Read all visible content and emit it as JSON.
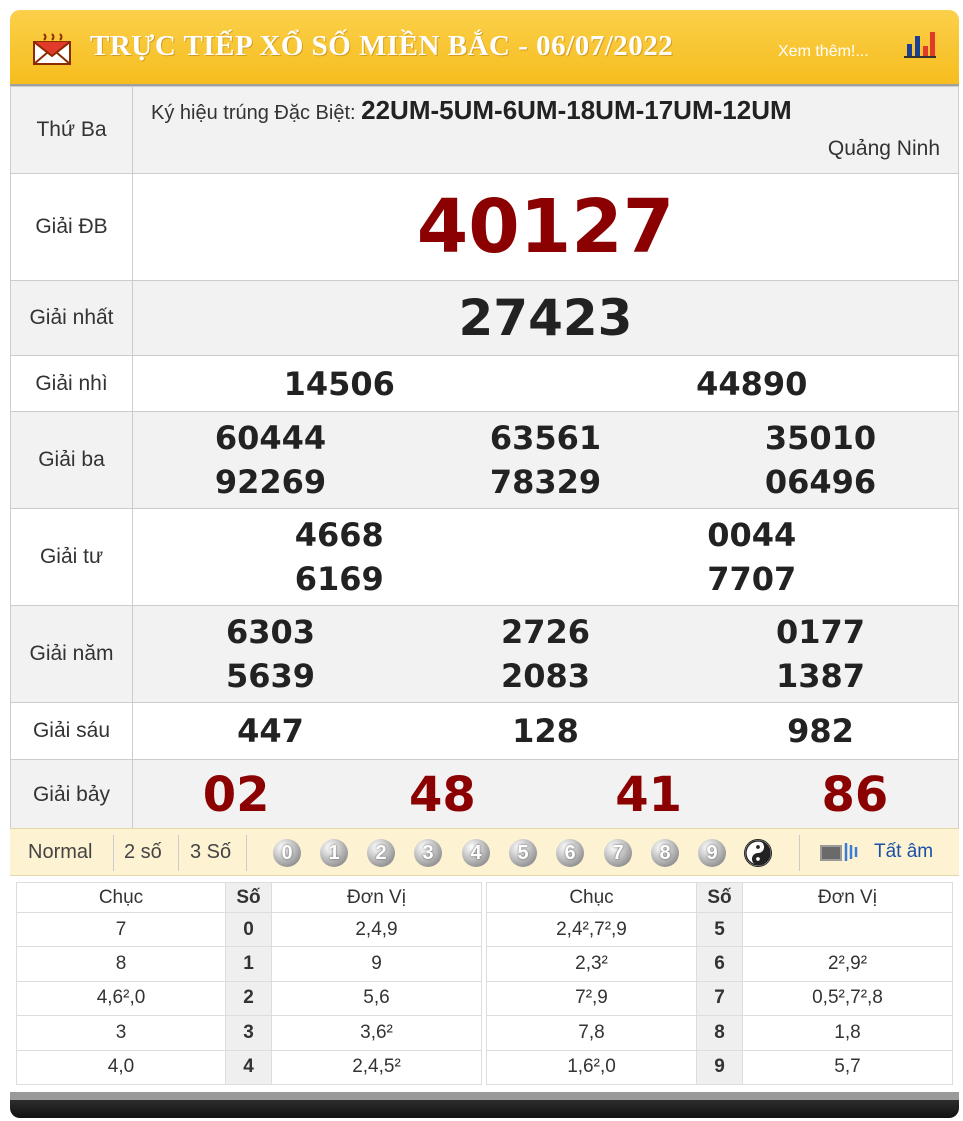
{
  "header": {
    "title": "TRỰC TIẾP XỔ SỐ MIỀN BẮC - 06/07/2022",
    "more_link": "Xem thêm!...",
    "colors": {
      "bar": "#f6bd1e",
      "title_text": "#ffffff"
    },
    "icons": [
      "mail-icon",
      "bar-chart-icon"
    ]
  },
  "draw": {
    "weekday": "Thứ Ba",
    "symbol_label": "Ký hiệu trúng Đặc Biệt:",
    "symbols": "22UM-5UM-6UM-18UM-17UM-12UM",
    "province": "Quảng Ninh"
  },
  "prizes": {
    "db": {
      "label": "Giải ĐB",
      "numbers": [
        "40127"
      ]
    },
    "g1": {
      "label": "Giải nhất",
      "numbers": [
        "27423"
      ]
    },
    "g2": {
      "label": "Giải nhì",
      "numbers": [
        "14506",
        "44890"
      ]
    },
    "g3": {
      "label": "Giải ba",
      "numbers": [
        "60444",
        "63561",
        "35010",
        "92269",
        "78329",
        "06496"
      ]
    },
    "g4": {
      "label": "Giải tư",
      "numbers": [
        "4668",
        "0044",
        "6169",
        "7707"
      ]
    },
    "g5": {
      "label": "Giải năm",
      "numbers": [
        "6303",
        "2726",
        "0177",
        "5639",
        "2083",
        "1387"
      ]
    },
    "g6": {
      "label": "Giải sáu",
      "numbers": [
        "447",
        "128",
        "982"
      ]
    },
    "g7": {
      "label": "Giải bảy",
      "numbers": [
        "02",
        "48",
        "41",
        "86"
      ]
    }
  },
  "highlight_color": "#8b0000",
  "filter": {
    "options": [
      "Normal",
      "2 số",
      "3 Số"
    ],
    "digits": [
      "0",
      "1",
      "2",
      "3",
      "4",
      "5",
      "6",
      "7",
      "8",
      "9"
    ],
    "mute_label": "Tất âm"
  },
  "loto": {
    "headers": {
      "chuc": "Chục",
      "so": "Số",
      "donvi": "Đơn Vị"
    },
    "left": [
      {
        "chuc": "7",
        "so": "0",
        "donvi": "2,4,9"
      },
      {
        "chuc": "8",
        "so": "1",
        "donvi": "9"
      },
      {
        "chuc": "4,6²,0",
        "so": "2",
        "donvi": "5,6"
      },
      {
        "chuc": "3",
        "so": "3",
        "donvi": "3,6²"
      },
      {
        "chuc": "4,0",
        "so": "4",
        "donvi": "2,4,5²"
      }
    ],
    "right": [
      {
        "chuc": "2,4²,7²,9",
        "so": "5",
        "donvi": ""
      },
      {
        "chuc": "2,3²",
        "so": "6",
        "donvi": "2²,9²"
      },
      {
        "chuc": "7²,9",
        "so": "7",
        "donvi": "0,5²,7²,8"
      },
      {
        "chuc": "7,8",
        "so": "8",
        "donvi": "1,8"
      },
      {
        "chuc": "1,6²,0",
        "so": "9",
        "donvi": "5,7"
      }
    ]
  }
}
